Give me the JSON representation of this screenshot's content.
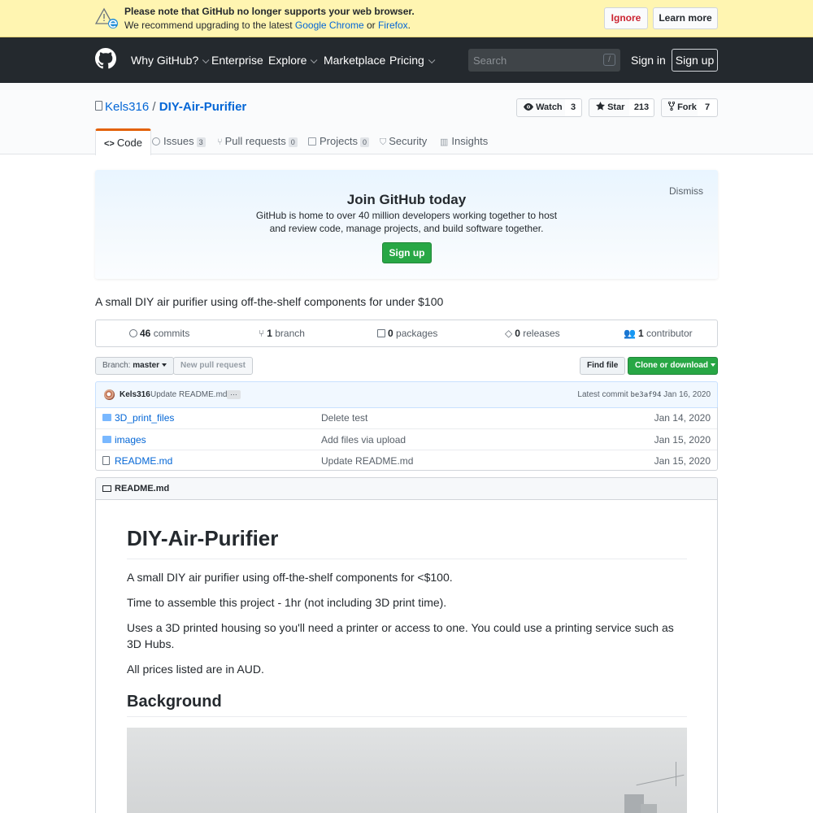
{
  "browser_warning": {
    "line1": "Please note that GitHub no longer supports your web browser.",
    "line2_prefix": "We recommend upgrading to the latest ",
    "chrome_link": "Google Chrome",
    "or": " or ",
    "firefox_link": "Firefox",
    "line2_suffix": ".",
    "ignore_label": "Ignore",
    "learn_more_label": "Learn more"
  },
  "header": {
    "nav": [
      "Why GitHub?",
      "Enterprise",
      "Explore",
      "Marketplace",
      "Pricing"
    ],
    "search_placeholder": "Search",
    "search_key": "/",
    "sign_in": "Sign in",
    "sign_up": "Sign up"
  },
  "repo": {
    "owner": "Kels316",
    "separator": "/",
    "name": "DIY-Air-Purifier",
    "watch_label": "Watch",
    "watch_count": "3",
    "star_label": "Star",
    "star_count": "213",
    "fork_label": "Fork",
    "fork_count": "7",
    "tabs": [
      {
        "label": "Code"
      },
      {
        "label": "Issues",
        "count": "3"
      },
      {
        "label": "Pull requests",
        "count": "0"
      },
      {
        "label": "Projects",
        "count": "0"
      },
      {
        "label": "Security"
      },
      {
        "label": "Insights"
      }
    ]
  },
  "join_banner": {
    "title": "Join GitHub today",
    "text": "GitHub is home to over 40 million developers working together to host and review code, manage projects, and build software together.",
    "sign_up": "Sign up",
    "dismiss": "Dismiss"
  },
  "description": "A small DIY air purifier using off-the-shelf components for under $100",
  "summary": {
    "commits_count": "46",
    "commits_label": "commits",
    "branch_count": "1",
    "branch_label": "branch",
    "packages_count": "0",
    "packages_label": "packages",
    "releases_count": "0",
    "releases_label": "releases",
    "contributor_count": "1",
    "contributor_label": "contributor"
  },
  "toolbar": {
    "branch_prefix": "Branch: ",
    "branch": "master",
    "new_pull_request": "New pull request",
    "find_file": "Find file",
    "clone": "Clone or download"
  },
  "latest_commit": {
    "author": "Kels316",
    "message": "Update README.md",
    "ellipsis": "…",
    "prefix": "Latest commit ",
    "sha": "be3af94",
    "date": "Jan 16, 2020"
  },
  "files": [
    {
      "name": "3D_print_files",
      "message": "Delete test",
      "date": "Jan 14, 2020",
      "type": "folder"
    },
    {
      "name": "images",
      "message": "Add files via upload",
      "date": "Jan 15, 2020",
      "type": "folder"
    },
    {
      "name": "README.md",
      "message": "Update README.md",
      "date": "Jan 15, 2020",
      "type": "file"
    }
  ],
  "readme": {
    "header": "README.md",
    "title": "DIY-Air-Purifier",
    "paragraphs": [
      "A small DIY air purifier using off-the-shelf components for <$100.",
      "Time to assemble this project - 1hr (not including 3D print time).",
      "Uses a 3D printed housing so you'll need a printer or access to one. You could use a printing service such as 3D Hubs.",
      "All prices listed are in AUD."
    ],
    "section": "Background"
  },
  "colors": {
    "accent": "#0366d6",
    "header_bg": "#24292e",
    "warning_bg": "#fff5b1",
    "success": "#28a745",
    "tab_highlight": "#e36209"
  }
}
